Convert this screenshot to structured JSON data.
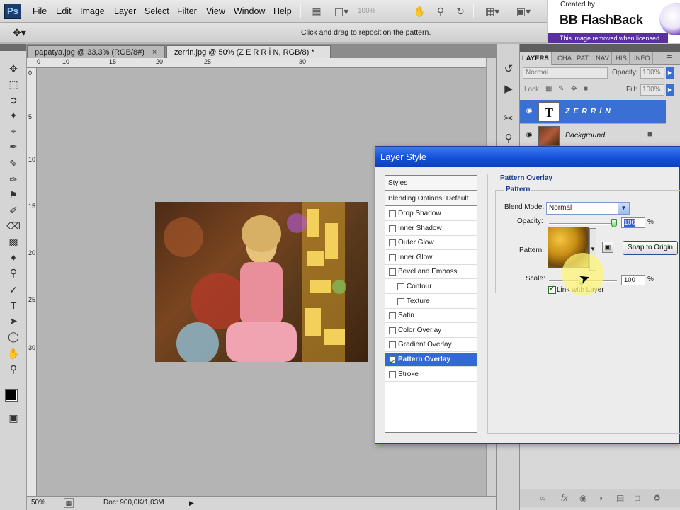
{
  "app": {
    "logo": "Ps",
    "menu": [
      "File",
      "Edit",
      "Image",
      "Layer",
      "Select",
      "Filter",
      "View",
      "Window",
      "Help"
    ],
    "zoom_display": "100%",
    "icons": [
      "bridge-icon",
      "mini-bridge-icon",
      "hand-icon",
      "zoom-icon",
      "rotate-view-icon",
      "arrange-documents-icon",
      "screen-mode-icon"
    ]
  },
  "watermark": {
    "created_by": "Created by",
    "name": "BB FlashBack",
    "notice": "This image removed when licensed"
  },
  "options_bar": {
    "tool_icon": "move-pattern-icon",
    "hint": "Click and drag to reposition the pattern."
  },
  "toolbar": {
    "tools": [
      "move-tool-icon",
      "marquee-tool-icon",
      "lasso-tool-icon",
      "magic-wand-tool-icon",
      "crop-tool-icon",
      "eyedropper-tool-icon",
      "healing-brush-icon",
      "brush-tool-icon",
      "clone-stamp-icon",
      "history-brush-icon",
      "eraser-tool-icon",
      "gradient-tool-icon",
      "blur-tool-icon",
      "dodge-tool-icon",
      "pen-tool-icon",
      "type-tool-icon",
      "path-selection-icon",
      "shape-tool-icon",
      "hand-tool-icon",
      "zoom-tool-icon"
    ],
    "foreground_color": "#000000",
    "background_color": "#ffffff"
  },
  "document": {
    "tabs": [
      {
        "label": "papatya.jpg @ 33,3% (RGB/8#)",
        "active": false
      },
      {
        "label": "zerrin.jpg @ 50% (Z E R R İ N, RGB/8) *",
        "active": true
      }
    ],
    "ruler_labels": [
      "0",
      "5",
      "10",
      "15",
      "20",
      "25",
      "30"
    ],
    "vertical_ruler_labels": [
      "0",
      "5",
      "10",
      "15",
      "20",
      "25",
      "30"
    ],
    "zoom": "50%",
    "doc_info": "Doc: 900,0K/1,03M"
  },
  "layers_panel": {
    "tabs": [
      "LAYERS",
      "CHA",
      "PAT",
      "NAV",
      "HIS",
      "INFO"
    ],
    "blend_mode": "Normal",
    "opacity_label": "Opacity:",
    "opacity_value": "100%",
    "lock_label": "Lock:",
    "fill_label": "Fill:",
    "fill_value": "100%",
    "layers": [
      {
        "name": "Z E R R İ N",
        "thumb": "T",
        "selected": true
      },
      {
        "name": "Background",
        "thumb": "",
        "selected": false
      }
    ]
  },
  "layer_style": {
    "title": "Layer Style",
    "styles_header": "Styles",
    "blending_options": "Blending Options: Default",
    "effects": [
      {
        "label": "Drop Shadow",
        "checked": false,
        "indent": false
      },
      {
        "label": "Inner Shadow",
        "checked": false,
        "indent": false
      },
      {
        "label": "Outer Glow",
        "checked": false,
        "indent": false
      },
      {
        "label": "Inner Glow",
        "checked": false,
        "indent": false
      },
      {
        "label": "Bevel and Emboss",
        "checked": false,
        "indent": false
      },
      {
        "label": "Contour",
        "checked": false,
        "indent": true
      },
      {
        "label": "Texture",
        "checked": false,
        "indent": true
      },
      {
        "label": "Satin",
        "checked": false,
        "indent": false
      },
      {
        "label": "Color Overlay",
        "checked": false,
        "indent": false
      },
      {
        "label": "Gradient Overlay",
        "checked": false,
        "indent": false
      },
      {
        "label": "Pattern Overlay",
        "checked": true,
        "indent": false,
        "selected": true
      },
      {
        "label": "Stroke",
        "checked": false,
        "indent": false
      }
    ],
    "section_title": "Pattern Overlay",
    "group_title": "Pattern",
    "blend_mode_label": "Blend Mode:",
    "blend_mode_value": "Normal",
    "opacity_label": "Opacity:",
    "opacity_value": "100",
    "pattern_label": "Pattern:",
    "snap_button": "Snap to Origin",
    "scale_label": "Scale:",
    "scale_value": "100",
    "percent": "%",
    "link_label": "Link with Layer",
    "link_checked": true
  }
}
